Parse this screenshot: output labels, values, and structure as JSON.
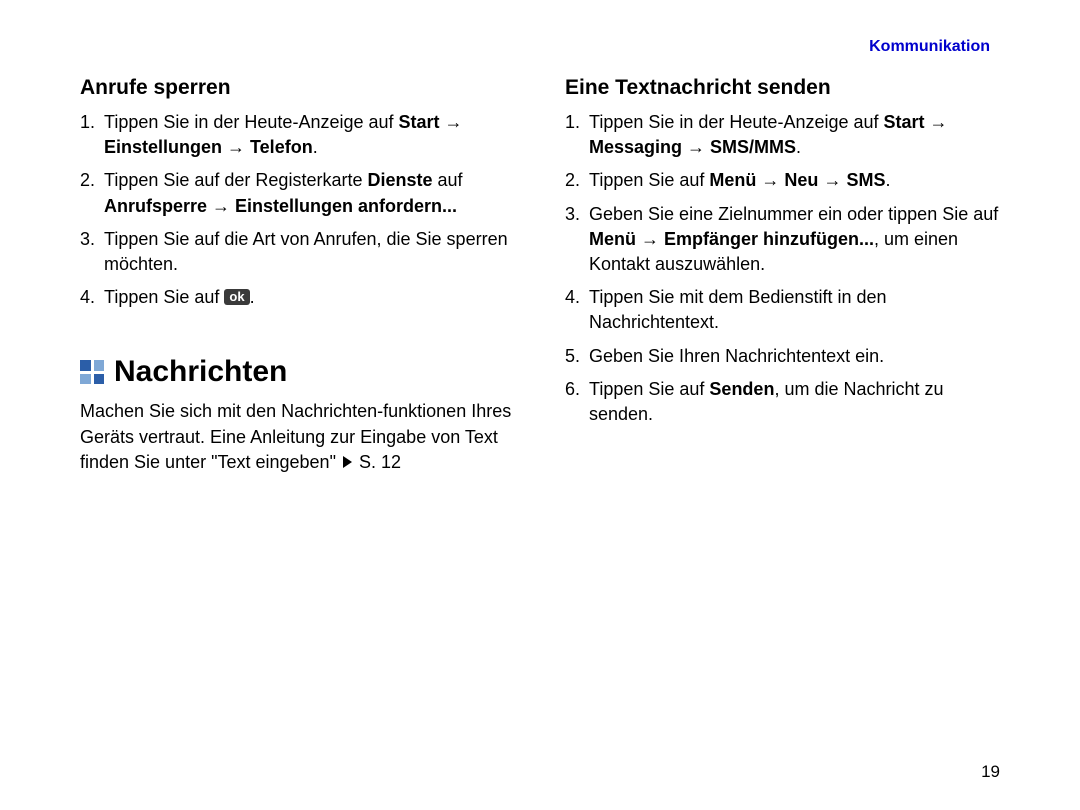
{
  "header": {
    "category": "Kommunikation"
  },
  "pageNumber": "19",
  "arrow": "→",
  "left": {
    "sub1": {
      "title": "Anrufe sperren"
    },
    "steps1": {
      "s1a": "Tippen Sie in der Heute-Anzeige auf ",
      "s1b": "Start ",
      "s1c": " Einstellungen ",
      "s1d": " Telefon",
      "s1e": ".",
      "s2a": "Tippen Sie auf der Registerkarte ",
      "s2b": "Dienste",
      "s2c": " auf ",
      "s2d": "Anrufsperre ",
      "s2e": " Einstellungen anfordern...",
      "s3": "Tippen Sie auf die Art von Anrufen, die Sie sperren möchten.",
      "s4a": "Tippen Sie auf ",
      "s4ok": "ok",
      "s4b": "."
    },
    "section": {
      "title": "Nachrichten"
    },
    "intro": {
      "t1": "Machen Sie sich mit den Nachrichten-funktionen Ihres Geräts vertraut. Eine Anleitung zur Eingabe von Text finden Sie unter \"Text eingeben\" ",
      "t2": " S. 12"
    }
  },
  "right": {
    "sub1": {
      "title": "Eine Textnachricht senden"
    },
    "steps": {
      "s1a": "Tippen Sie in der Heute-Anzeige auf ",
      "s1b": "Start ",
      "s1c": " Messaging ",
      "s1d": " SMS/MMS",
      "s1e": ".",
      "s2a": "Tippen Sie auf ",
      "s2b": "Menü ",
      "s2c": " Neu ",
      "s2d": " SMS",
      "s2e": ".",
      "s3a": "Geben Sie eine Zielnummer ein oder tippen Sie auf ",
      "s3b": "Menü ",
      "s3c": " Empfänger hinzufügen...",
      "s3d": ", um einen Kontakt auszuwählen.",
      "s4": "Tippen Sie mit dem Bedienstift in den Nachrichtentext.",
      "s5": "Geben Sie Ihren Nachrichtentext ein.",
      "s6a": "Tippen Sie auf ",
      "s6b": "Senden",
      "s6c": ", um die Nachricht zu senden."
    }
  }
}
